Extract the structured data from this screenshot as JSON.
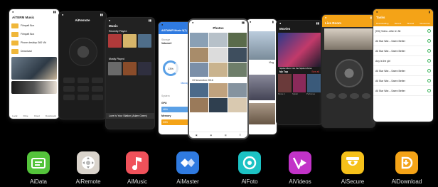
{
  "phones": {
    "data": {
      "header": "AiTERM Music",
      "rows": [
        "Filmyaft Box",
        "Filmyaft Box",
        "Phone desktop 360 Vid",
        "Download"
      ],
      "nav": [
        "Local",
        "Drive",
        "Cloud",
        "Downloads"
      ]
    },
    "remote": {
      "title": "AiRemote"
    },
    "music": {
      "title": "Music",
      "section1": "Recently Played",
      "section2": "Mostly Played",
      "now_playing": "Love Is Your Station (Adam Gwen)"
    },
    "master": {
      "title": "AiSTAWIFI Music 5(?)",
      "storage_label": "Storage",
      "volume_label": "Volume2",
      "percent": "13%",
      "manage": "Manage",
      "system_label": "System",
      "gpu_label": "GPU",
      "gpu_value": "46%",
      "memory_label": "Memory",
      "memory_value": "33%"
    },
    "foto": {
      "title": "Photos",
      "date": "19 November 2016"
    },
    "videos_light": {
      "label": "Vlog"
    },
    "videos_dark": {
      "title": "Movies",
      "feature": "Spider-Man: Into the Spider-Verse",
      "section": "My Top",
      "more": "See all",
      "items": [
        "Movie 1",
        "Spider",
        "Perfumes"
      ]
    },
    "remote_orange": {
      "title": "Live Room"
    },
    "download": {
      "title": "Tasks",
      "tabs": [
        "Downloading",
        "Recent",
        "Shared",
        "Resources"
      ],
      "rows": [
        "[HD] Video..other in 36",
        "All Star War....Saren Better",
        "All Star War....Saren Better",
        "Any is the girl",
        "All Star War....Saren Better",
        "All Star War....Saren Better",
        "All Star War....Saren Better"
      ]
    }
  },
  "apps": [
    {
      "name": "AiData",
      "color": "#54c43b",
      "icon": "folder-card-icon"
    },
    {
      "name": "AiRemote",
      "color": "#d9d3cb",
      "icon": "remote-dpad-icon"
    },
    {
      "name": "AiMusic",
      "color": "#f0515a",
      "icon": "music-note-icon"
    },
    {
      "name": "AiMaster",
      "color": "#2f7ae0",
      "icon": "diamond-arrows-icon"
    },
    {
      "name": "AiFoto",
      "color": "#1cc2c4",
      "icon": "camera-lens-icon"
    },
    {
      "name": "AiVideos",
      "color": "#c233c8",
      "icon": "play-v-icon"
    },
    {
      "name": "AiSecure",
      "color": "#f6c11a",
      "icon": "security-camera-icon"
    },
    {
      "name": "AiDownload",
      "color": "#f4a317",
      "icon": "download-icon"
    }
  ]
}
